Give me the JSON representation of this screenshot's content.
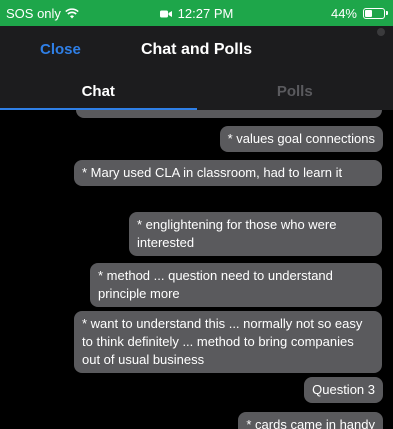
{
  "status_bar": {
    "carrier": "SOS only",
    "wifi_icon": "wifi-icon",
    "time": "12:27 PM",
    "camera_icon": "camera-icon",
    "battery": "44%",
    "battery_level": 0.44
  },
  "header": {
    "close_label": "Close",
    "title": "Chat and Polls"
  },
  "tabs": [
    {
      "label": "Chat",
      "active": true
    },
    {
      "label": "Polls",
      "active": false
    }
  ],
  "messages": [
    "* values goal connections",
    "* Mary used CLA in classroom, had to learn it",
    "* englightening for those who were interested",
    "* method ... question need to understand principle more",
    "* want to understand this ... normally not so easy to think definitely ... method to bring companies out of usual business",
    "Question 3",
    "* cards came in handy"
  ],
  "colors": {
    "status_bar": "#1ea64a",
    "accent": "#2f7fe6",
    "bubble": "#5a5a5d",
    "header": "#1c1c1e"
  }
}
